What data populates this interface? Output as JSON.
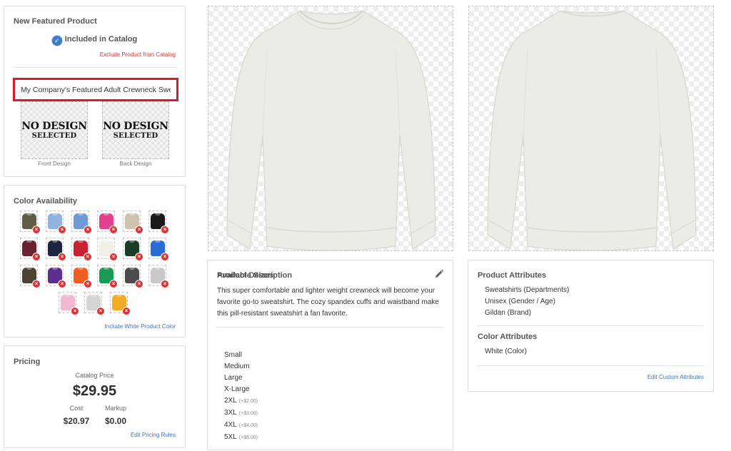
{
  "product": {
    "title": "New Featured Product",
    "included_label": "Included in Catalog",
    "exclude_link": "Exclude Product from Catalog",
    "name_value": "My Company's Featured Adult Crewneck Swe",
    "front_design_text": {
      "line1": "NO DESIGN",
      "line2": "SELECTED"
    },
    "back_design_text": {
      "line1": "NO DESIGN",
      "line2": "SELECTED"
    },
    "front_label": "Front Design",
    "back_label": "Back Design"
  },
  "colors": {
    "title": "Color Availability",
    "include_white_link": "Include White Product Color",
    "swatches": [
      "#5f5e44",
      "#8fb3de",
      "#6f9ad8",
      "#e2418c",
      "#cfc2ad",
      "#1a1a1a",
      "#6a2230",
      "#1c2540",
      "#c82233",
      "#f3efe6",
      "#1c3d27",
      "#2a6cd4",
      "#4d4234",
      "#5c2e8e",
      "#f15c20",
      "#1a9b55",
      "#4c4c4c",
      "#c9c9c9",
      "#f1b8cf",
      "#d4d4d4",
      "#f3ab23"
    ]
  },
  "pricing": {
    "title": "Pricing",
    "catalog_label": "Catalog Price",
    "catalog_price": "$29.95",
    "cost_label": "Cost",
    "cost_value": "$20.97",
    "markup_label": "Markup",
    "markup_value": "$0.00",
    "edit_link": "Edit Pricing Rules"
  },
  "description": {
    "title": "Product Description",
    "text": "This super comfortable and lighter weight crewneck will become your favorite go-to sweatshirt. The cozy spandex cuffs and waistband make this pill-resistant sweatshirt a fan favorite.",
    "sizes_title": "Available Sizes",
    "sizes": [
      {
        "name": "Small",
        "upcharge": ""
      },
      {
        "name": "Medium",
        "upcharge": ""
      },
      {
        "name": "Large",
        "upcharge": ""
      },
      {
        "name": "X-Large",
        "upcharge": ""
      },
      {
        "name": "2XL",
        "upcharge": "(+$2.00)"
      },
      {
        "name": "3XL",
        "upcharge": "(+$3.00)"
      },
      {
        "name": "4XL",
        "upcharge": "(+$4.00)"
      },
      {
        "name": "5XL",
        "upcharge": "(+$6.00)"
      }
    ]
  },
  "attributes": {
    "product_title": "Product Attributes",
    "product_items": [
      "Sweatshirts (Departments)",
      "Unisex (Gender / Age)",
      "Gildan (Brand)"
    ],
    "color_title": "Color Attributes",
    "color_items": [
      "White (Color)"
    ],
    "edit_link": "Edit Custom Attributes"
  },
  "theme": {
    "link_color": "#3f74b5",
    "danger_color": "#d03838",
    "highlight_border": "#d21e28",
    "shirt_color": "#ecece6"
  },
  "icons": {
    "check": "check-circle-icon",
    "remove": "remove-x-icon",
    "edit": "pencil-icon"
  }
}
